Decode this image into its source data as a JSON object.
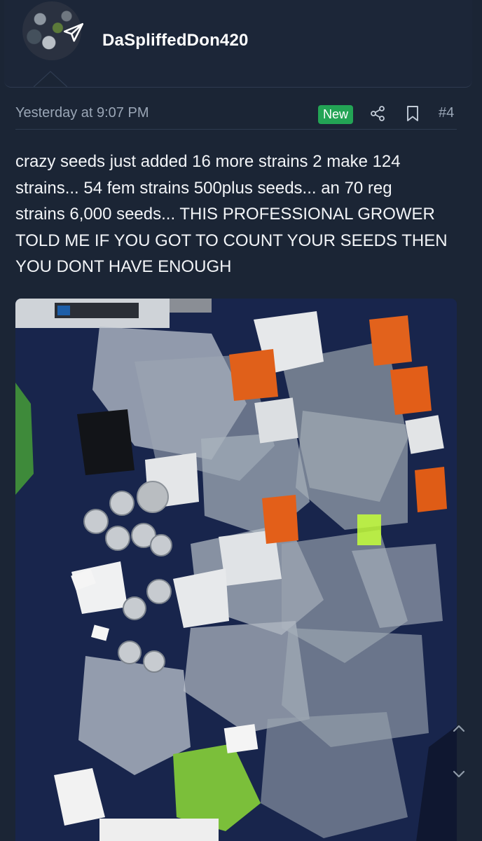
{
  "post": {
    "username": "DaSpliffedDon420",
    "timestamp": "Yesterday at 9:07 PM",
    "badge": "New",
    "post_number": "#4",
    "body": "crazy seeds just added 16 more strains 2 make 124\nstrains... 54 fem strains 500plus seeds... an 70 reg\nstrains 6,000 seeds... THIS PROFESSIONAL GROWER\nTOLD ME IF YOU GOT TO COUNT YOUR SEEDS THEN\nYOU DONT HAVE ENOUGH"
  },
  "icons": {
    "avatar_badge": "send-icon",
    "share": "share-icon",
    "bookmark": "bookmark-icon",
    "scroll_up": "chevron-up-icon",
    "scroll_down": "chevron-down-icon"
  },
  "colors": {
    "background": "#1b2535",
    "badge_green": "#23a455",
    "muted_text": "#9aa6b6",
    "photo_surface": "#17244a"
  }
}
